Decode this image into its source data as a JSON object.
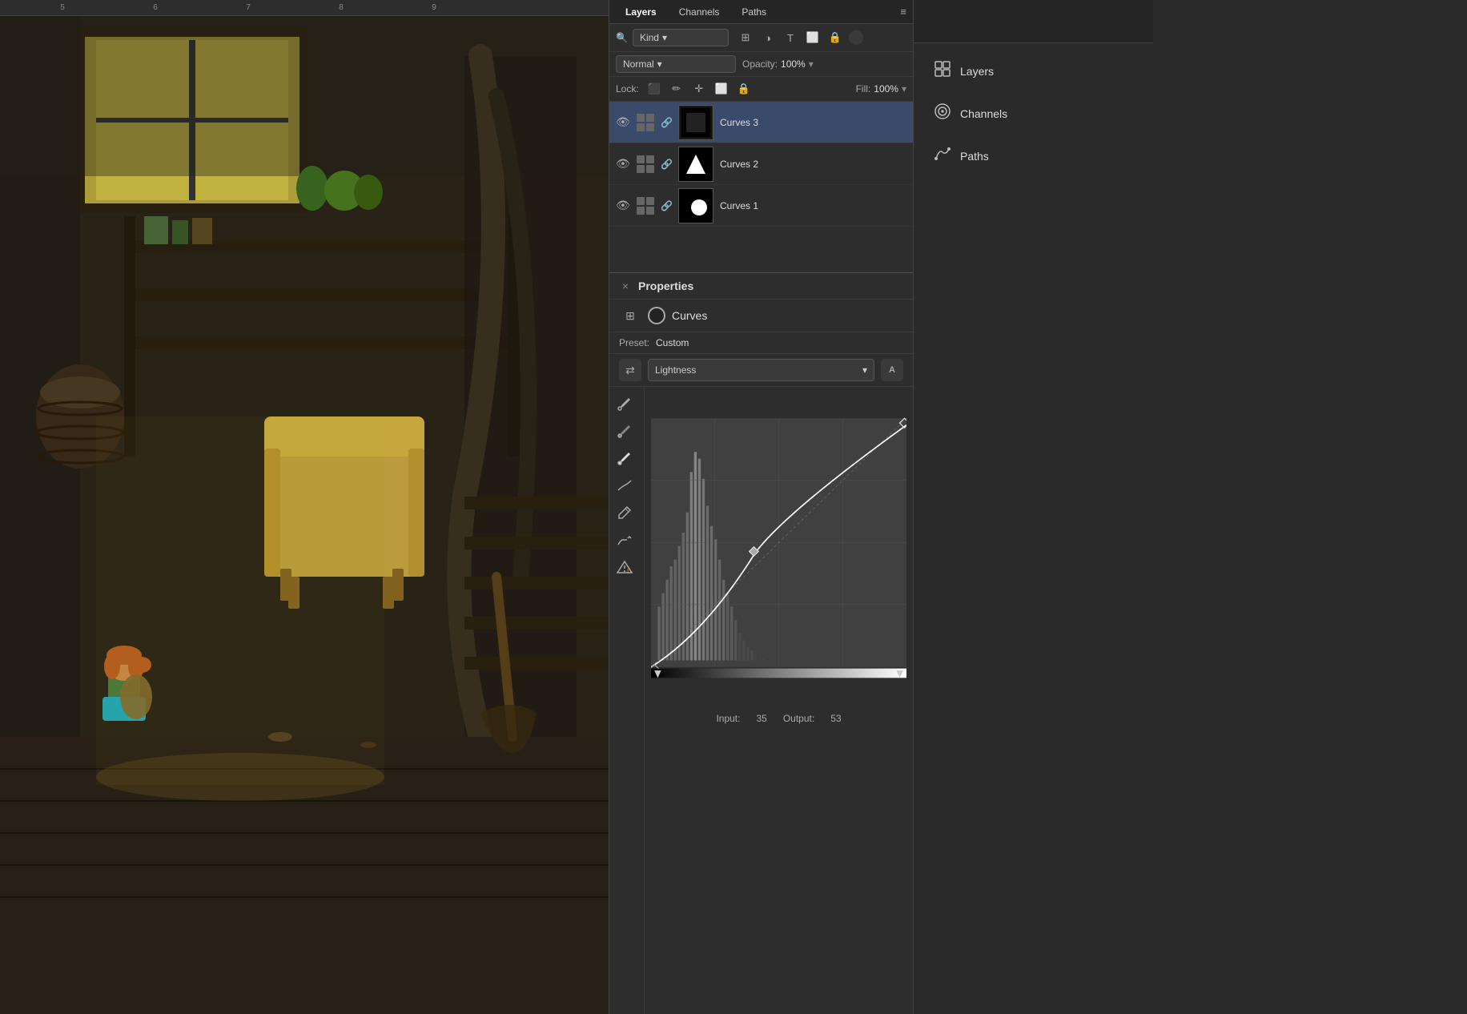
{
  "ruler": {
    "marks": [
      "5",
      "6",
      "7",
      "8",
      "9"
    ]
  },
  "layers_panel": {
    "tabs": [
      {
        "label": "Layers",
        "active": true
      },
      {
        "label": "Channels",
        "active": false
      },
      {
        "label": "Paths",
        "active": false
      }
    ],
    "kind_label": "Kind",
    "blend_mode": "Normal",
    "opacity_label": "Opacity:",
    "opacity_value": "100%",
    "lock_label": "Lock:",
    "fill_label": "Fill:",
    "fill_value": "100%",
    "layers": [
      {
        "name": "Curves 3",
        "selected": true,
        "thumb": "curves3"
      },
      {
        "name": "Curves 2",
        "selected": false,
        "thumb": "curves2"
      },
      {
        "name": "Curves 1",
        "selected": false,
        "thumb": "curves1"
      }
    ]
  },
  "properties_panel": {
    "title": "Properties",
    "close_icon": "×",
    "section": "Curves",
    "preset_label": "Preset:",
    "preset_value": "Custom",
    "channel_label": "Lightness",
    "auto_label": "A",
    "input_label": "Input:",
    "input_value": "35",
    "output_label": "Output:",
    "output_value": "53"
  },
  "right_panel": {
    "tabs": [
      {
        "label": "Layers",
        "icon": "⊞",
        "active": true
      },
      {
        "label": "Channels",
        "icon": "◎",
        "active": false
      },
      {
        "label": "Paths",
        "icon": "✎",
        "active": false
      }
    ],
    "items": [
      {
        "label": "Layers",
        "icon": "⊞"
      },
      {
        "label": "Channels",
        "icon": "◎"
      },
      {
        "label": "Paths",
        "icon": "✎"
      }
    ]
  },
  "icons": {
    "eye": "👁",
    "link": "🔗",
    "chevron_down": "▾",
    "search": "🔍",
    "lock_pixels": "⬛",
    "lock_image": "✏",
    "lock_position": "✛",
    "lock_artboard": "⬜",
    "lock_all": "🔒",
    "eyedropper": "⊘",
    "curve_tool": "∿",
    "pencil": "✏",
    "warning": "⚠"
  }
}
